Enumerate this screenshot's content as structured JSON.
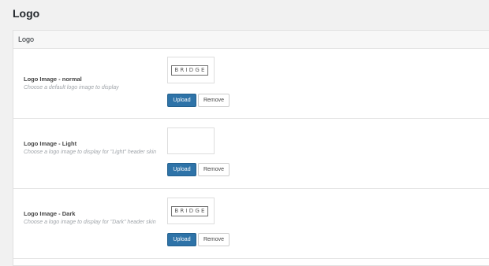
{
  "page": {
    "title": "Logo"
  },
  "panel": {
    "header": "Logo",
    "fields": [
      {
        "label": "Logo Image - normal",
        "description": "Choose a default logo image to display",
        "preview_text": "BRIDGE",
        "upload_label": "Upload",
        "remove_label": "Remove"
      },
      {
        "label": "Logo Image - Light",
        "description": "Choose a logo image to display for \"Light\" header skin",
        "preview_text": "",
        "upload_label": "Upload",
        "remove_label": "Remove"
      },
      {
        "label": "Logo Image - Dark",
        "description": "Choose a logo image to display for \"Dark\" header skin",
        "preview_text": "BRIDGE",
        "upload_label": "Upload",
        "remove_label": "Remove"
      }
    ]
  },
  "colors": {
    "page_background": "#f1f1f1",
    "panel_background": "#ffffff",
    "upload_button": "#2e73a8",
    "description_text": "#a0a5aa"
  }
}
